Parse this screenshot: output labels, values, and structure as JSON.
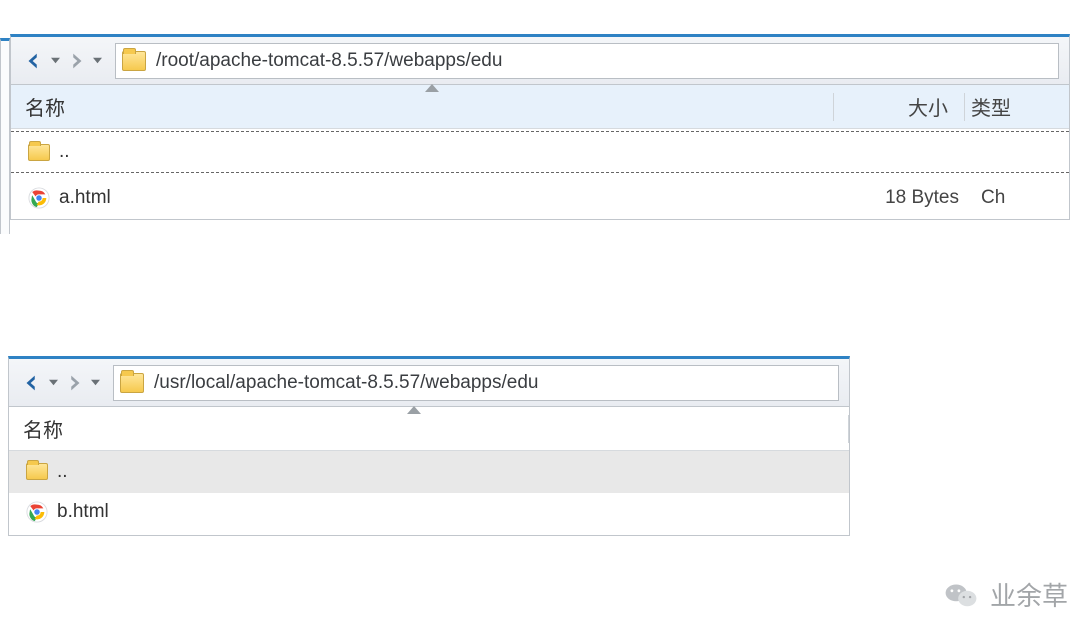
{
  "panels": [
    {
      "path": "/root/apache-tomcat-8.5.57/webapps/edu",
      "header_selected": true,
      "cols": {
        "name": "名称",
        "size": "大小",
        "type": "类型"
      },
      "type_truncated": "类型",
      "rows": [
        {
          "kind": "parent",
          "label": ".."
        },
        {
          "kind": "file",
          "label": "a.html",
          "size": "18 Bytes",
          "type": "Ch"
        }
      ]
    },
    {
      "path": "/usr/local/apache-tomcat-8.5.57/webapps/edu",
      "header_selected": false,
      "cols": {
        "name": "名称",
        "size": "",
        "type": ""
      },
      "rows": [
        {
          "kind": "parent-shade",
          "label": ".."
        },
        {
          "kind": "file",
          "label": "b.html",
          "size": "",
          "type": ""
        }
      ]
    }
  ],
  "watermark": "业余草"
}
